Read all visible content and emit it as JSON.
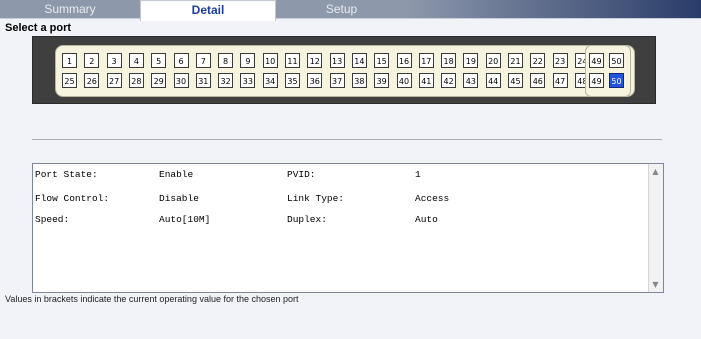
{
  "tabs": [
    {
      "label": "Summary"
    },
    {
      "label": "Detail"
    },
    {
      "label": "Setup"
    }
  ],
  "select_port_label": "Select a port",
  "ports_row1": [
    "1",
    "2",
    "3",
    "4",
    "5",
    "6",
    "7",
    "8",
    "9",
    "10",
    "11",
    "12",
    "13",
    "14",
    "15",
    "16",
    "17",
    "18",
    "19",
    "20",
    "21",
    "22",
    "23",
    "24"
  ],
  "ports_row2": [
    "25",
    "26",
    "27",
    "28",
    "29",
    "30",
    "31",
    "32",
    "33",
    "34",
    "35",
    "36",
    "37",
    "38",
    "39",
    "40",
    "41",
    "42",
    "43",
    "44",
    "45",
    "46",
    "47",
    "48"
  ],
  "uplinks_top": [
    "49",
    "50"
  ],
  "uplinks_bottom": [
    "49",
    "50"
  ],
  "selected_port": "50",
  "details": [
    {
      "label": "Port State:",
      "value": "Enable",
      "label2": "PVID:",
      "value2": "1"
    },
    {
      "label": "Flow Control:",
      "value": "Disable",
      "label2": "Link Type:",
      "value2": "Access"
    },
    {
      "label": "Speed:",
      "value": "Auto[10M]",
      "label2": "Duplex:",
      "value2": "Auto"
    }
  ],
  "footnote": "Values in brackets indicate the current operating value for the chosen port",
  "colors": {
    "selected_port": "#2454d9",
    "panel": "#3f3f3f",
    "tab_band_dark": "#2a3c69"
  }
}
